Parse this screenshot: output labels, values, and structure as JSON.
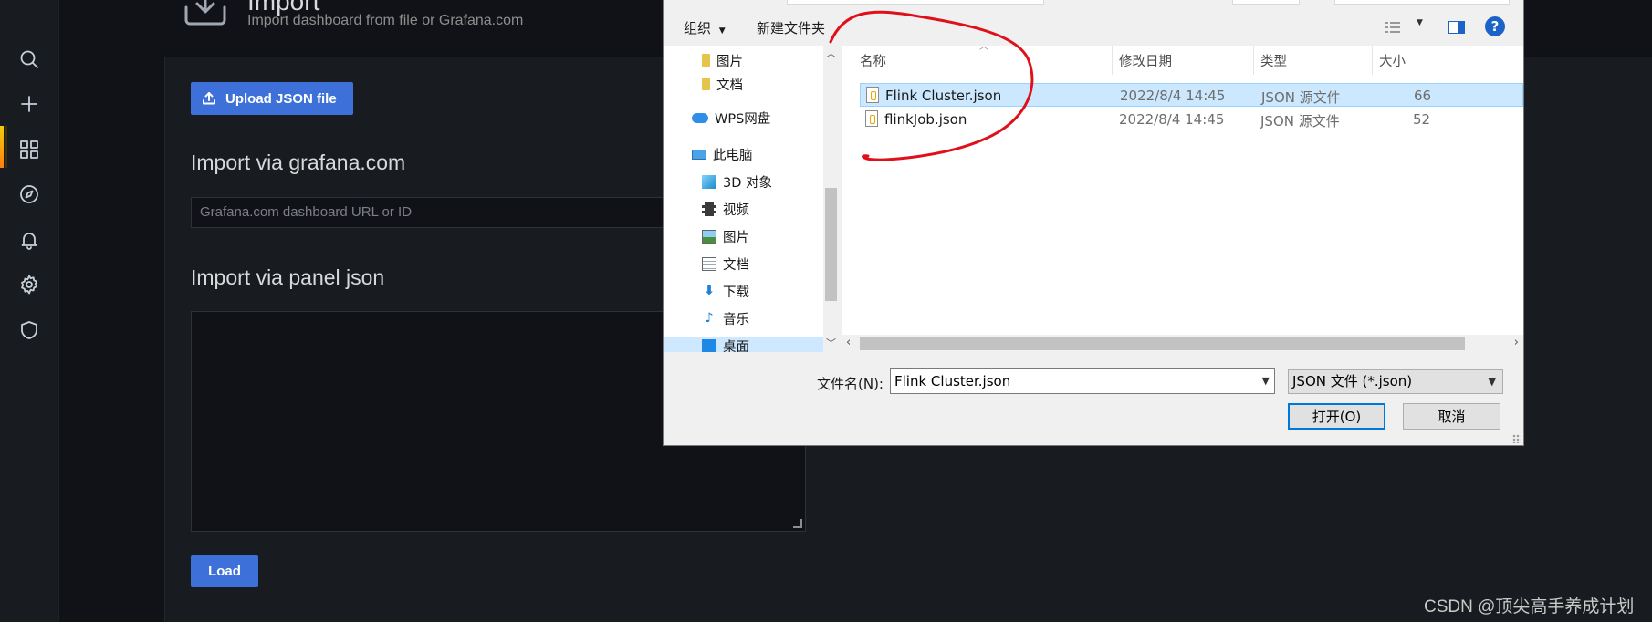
{
  "header": {
    "title": "Import",
    "subtitle": "Import dashboard from file or Grafana.com"
  },
  "sidemenu": {
    "icons": [
      "search-icon",
      "plus-icon",
      "dashboards-icon",
      "explore-icon",
      "alerting-icon",
      "configuration-icon",
      "shield-icon"
    ]
  },
  "import": {
    "upload_label": "Upload JSON file",
    "via_grafana_heading": "Import via grafana.com",
    "grafana_placeholder": "Grafana.com dashboard URL or ID",
    "via_panel_heading": "Import via panel json",
    "load_label": "Load"
  },
  "dialog": {
    "toolbar": {
      "organize": "组织",
      "new_folder": "新建文件夹"
    },
    "nav_items": [
      {
        "label": "图片",
        "icon": "folder-icon"
      },
      {
        "label": "文档",
        "icon": "folder-icon"
      },
      {
        "label": "WPS网盘",
        "icon": "cloud-icon"
      },
      {
        "label": "此电脑",
        "icon": "computer-icon"
      },
      {
        "label": "3D 对象",
        "icon": "3d-objects-icon"
      },
      {
        "label": "视频",
        "icon": "video-icon"
      },
      {
        "label": "图片",
        "icon": "pictures-icon"
      },
      {
        "label": "文档",
        "icon": "documents-icon"
      },
      {
        "label": "下载",
        "icon": "download-icon"
      },
      {
        "label": "音乐",
        "icon": "music-icon"
      },
      {
        "label": "桌面",
        "icon": "desktop-icon"
      }
    ],
    "columns": [
      "名称",
      "修改日期",
      "类型",
      "大小"
    ],
    "files": [
      {
        "name": "Flink Cluster.json",
        "date": "2022/8/4 14:45",
        "type": "JSON 源文件",
        "size": "66",
        "selected": true
      },
      {
        "name": "flinkJob.json",
        "date": "2022/8/4 14:45",
        "type": "JSON 源文件",
        "size": "52",
        "selected": false
      }
    ],
    "filename_label": "文件名(N):",
    "filename_value": "Flink Cluster.json",
    "filetype_value": "JSON 文件 (*.json)",
    "open_label": "打开(O)",
    "cancel_label": "取消"
  },
  "watermark": "CSDN @顶尖高手养成计划",
  "colors": {
    "accent": "#3d71d9",
    "selection": "#cce8ff",
    "annotation": "#e0101a"
  }
}
